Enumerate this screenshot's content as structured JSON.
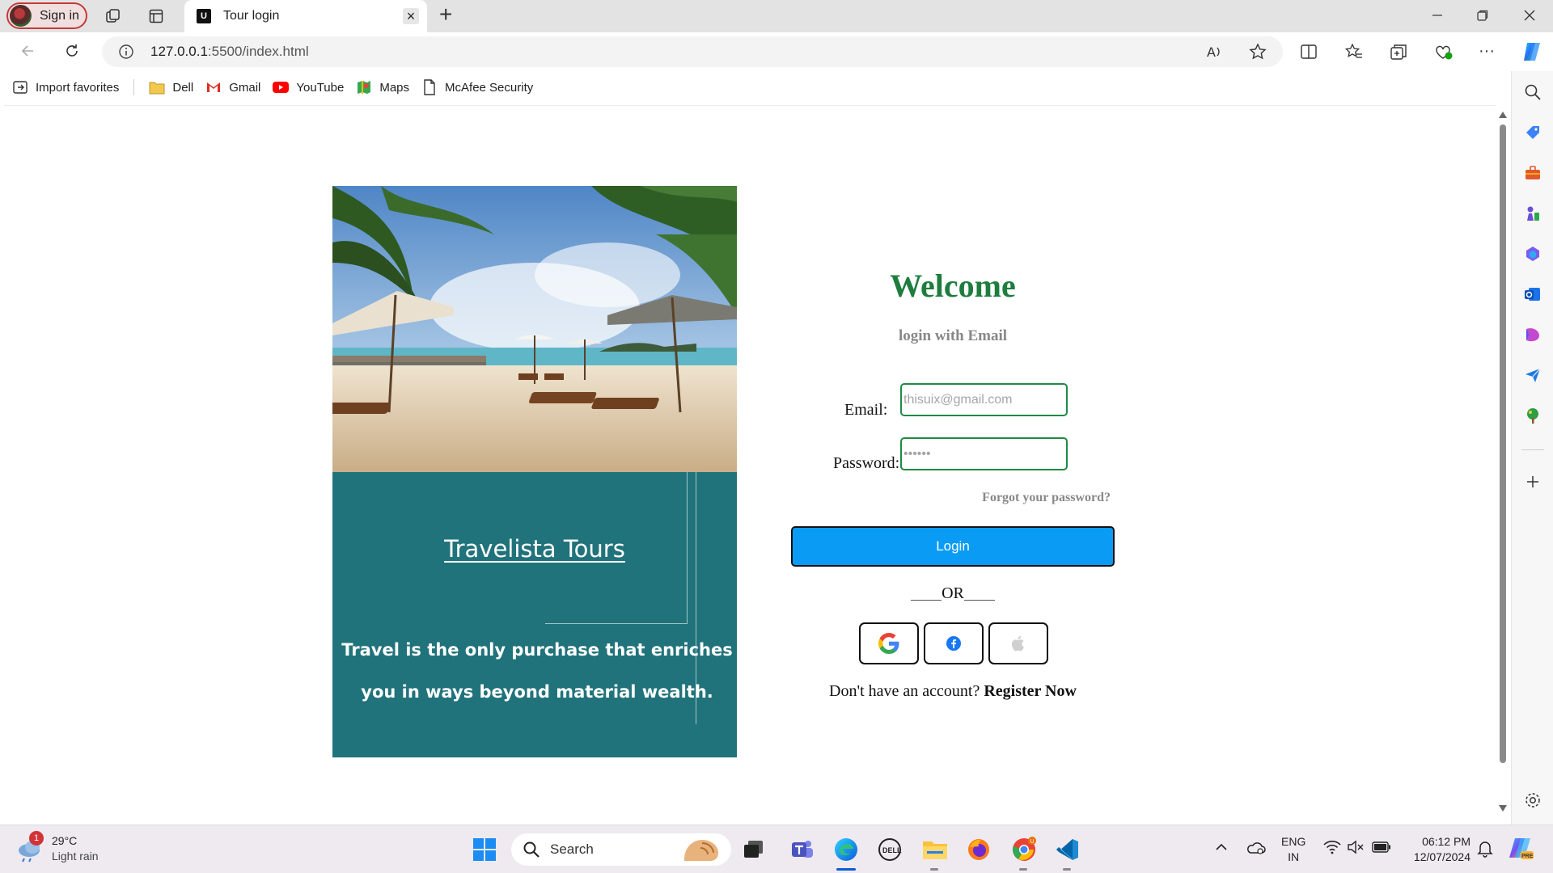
{
  "browser": {
    "signin_label": "Sign in",
    "tab_favicon_letter": "U",
    "tab_title": "Tour login",
    "url_host": "127.0.0.1",
    "url_rest": ":5500/index.html"
  },
  "favorites": [
    {
      "label": "Import favorites",
      "icon": "import-icon"
    },
    {
      "label": "Dell",
      "icon": "folder-icon"
    },
    {
      "label": "Gmail",
      "icon": "gmail-icon"
    },
    {
      "label": "YouTube",
      "icon": "youtube-icon"
    },
    {
      "label": "Maps",
      "icon": "maps-icon"
    },
    {
      "label": "McAfee Security",
      "icon": "page-icon"
    }
  ],
  "hero": {
    "brand": "Travelista Tours",
    "quote": "Travel is the only purchase that enriches you in ways beyond material wealth."
  },
  "login": {
    "title": "Welcome",
    "subtitle": "login with Email",
    "email_label": "Email:",
    "email_placeholder": "thisuix@gmail.com",
    "password_label": "Password:",
    "password_value": "••••••",
    "forgot": "Forgot your password?",
    "login_button": "Login",
    "or": "OR",
    "register_prompt": "Don't have an account?",
    "register_link": "Register Now"
  },
  "taskbar": {
    "weather_badge": "1",
    "weather_temp": "29°C",
    "weather_condition": "Light rain",
    "search_label": "Search",
    "lang_top": "ENG",
    "lang_bottom": "IN",
    "time": "06:12 PM",
    "date": "12/07/2024"
  },
  "colors": {
    "welcome_green": "#1e7d3e",
    "panel_teal": "#21737b",
    "login_blue": "#0a9bf5"
  }
}
